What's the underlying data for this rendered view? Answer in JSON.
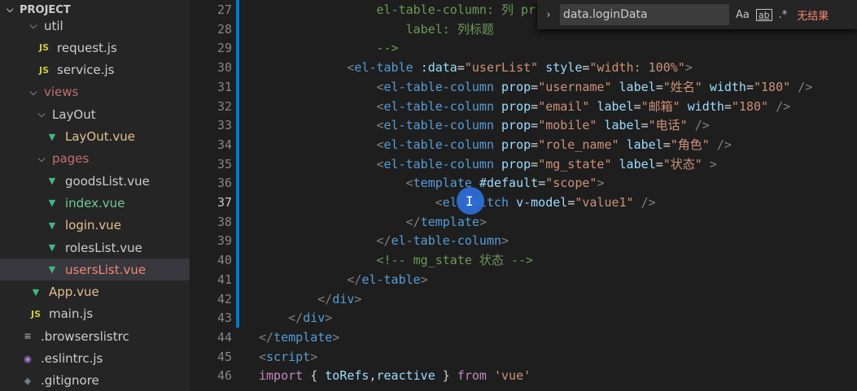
{
  "explorer": {
    "project_title": "PROJECT",
    "items": [
      {
        "name": "util",
        "kind": "folder",
        "expanded": true,
        "status": "dot"
      },
      {
        "name": "request.js",
        "kind": "js",
        "status": "M"
      },
      {
        "name": "service.js",
        "kind": "js",
        "status": "M"
      },
      {
        "name": "views",
        "kind": "folder",
        "expanded": true,
        "status": "dot"
      },
      {
        "name": "LayOut",
        "kind": "folder",
        "expanded": true,
        "status": "dot"
      },
      {
        "name": "LayOut.vue",
        "kind": "vue",
        "status": "M"
      },
      {
        "name": "pages",
        "kind": "folder",
        "expanded": true,
        "status": "dot"
      },
      {
        "name": "goodsList.vue",
        "kind": "vue",
        "status": ""
      },
      {
        "name": "index.vue",
        "kind": "vue",
        "status": "U"
      },
      {
        "name": "login.vue",
        "kind": "vue",
        "status": "M"
      },
      {
        "name": "rolesList.vue",
        "kind": "vue",
        "status": ""
      },
      {
        "name": "usersList.vue",
        "kind": "vue",
        "status": "1, M"
      },
      {
        "name": "App.vue",
        "kind": "vue",
        "status": "M"
      },
      {
        "name": "main.js",
        "kind": "js",
        "status": ""
      },
      {
        "name": ".browserslistrc",
        "kind": "lines",
        "status": ""
      },
      {
        "name": ".eslintrc.js",
        "kind": "eslint",
        "status": ""
      },
      {
        "name": ".gitignore",
        "kind": "git",
        "status": ""
      }
    ]
  },
  "find": {
    "query": "data.loginData",
    "case_label": "Aa",
    "word_label": "ab",
    "regex_label": ".*",
    "status": "无结果"
  },
  "editor": {
    "active_line": 37,
    "lines": [
      {
        "n": 27,
        "indent": "        ",
        "tokens": [
          [
            "cmt",
            "el-table-column: 列 pr"
          ]
        ]
      },
      {
        "n": 28,
        "indent": "          ",
        "tokens": [
          [
            "cmt",
            "label: 列标题"
          ]
        ]
      },
      {
        "n": 29,
        "indent": "        ",
        "tokens": [
          [
            "cmt",
            "-->"
          ]
        ]
      },
      {
        "n": 30,
        "indent": "      ",
        "tokens": [
          [
            "punct",
            "<"
          ],
          [
            "tag",
            "el-table"
          ],
          [
            "plain",
            " "
          ],
          [
            "attr",
            ":data"
          ],
          [
            "plain",
            "="
          ],
          [
            "str",
            "\"userList\""
          ],
          [
            "plain",
            " "
          ],
          [
            "attr",
            "style"
          ],
          [
            "plain",
            "="
          ],
          [
            "str",
            "\"width: 100%\""
          ],
          [
            "punct",
            ">"
          ]
        ]
      },
      {
        "n": 31,
        "indent": "        ",
        "tokens": [
          [
            "punct",
            "<"
          ],
          [
            "tag",
            "el-table-column"
          ],
          [
            "plain",
            " "
          ],
          [
            "attr",
            "prop"
          ],
          [
            "plain",
            "="
          ],
          [
            "str",
            "\"username\""
          ],
          [
            "plain",
            " "
          ],
          [
            "attr",
            "label"
          ],
          [
            "plain",
            "="
          ],
          [
            "str",
            "\"姓名\""
          ],
          [
            "plain",
            " "
          ],
          [
            "attr",
            "width"
          ],
          [
            "plain",
            "="
          ],
          [
            "str",
            "\"180\""
          ],
          [
            "plain",
            " "
          ],
          [
            "punct",
            "/>"
          ]
        ]
      },
      {
        "n": 32,
        "indent": "        ",
        "tokens": [
          [
            "punct",
            "<"
          ],
          [
            "tag",
            "el-table-column"
          ],
          [
            "plain",
            " "
          ],
          [
            "attr",
            "prop"
          ],
          [
            "plain",
            "="
          ],
          [
            "str",
            "\"email\""
          ],
          [
            "plain",
            " "
          ],
          [
            "attr",
            "label"
          ],
          [
            "plain",
            "="
          ],
          [
            "str",
            "\"邮箱\""
          ],
          [
            "plain",
            " "
          ],
          [
            "attr",
            "width"
          ],
          [
            "plain",
            "="
          ],
          [
            "str",
            "\"180\""
          ],
          [
            "plain",
            " "
          ],
          [
            "punct",
            "/>"
          ]
        ]
      },
      {
        "n": 33,
        "indent": "        ",
        "tokens": [
          [
            "punct",
            "<"
          ],
          [
            "tag",
            "el-table-column"
          ],
          [
            "plain",
            " "
          ],
          [
            "attr",
            "prop"
          ],
          [
            "plain",
            "="
          ],
          [
            "str",
            "\"mobile\""
          ],
          [
            "plain",
            " "
          ],
          [
            "attr",
            "label"
          ],
          [
            "plain",
            "="
          ],
          [
            "str",
            "\"电话\""
          ],
          [
            "plain",
            " "
          ],
          [
            "punct",
            "/>"
          ]
        ]
      },
      {
        "n": 34,
        "indent": "        ",
        "tokens": [
          [
            "punct",
            "<"
          ],
          [
            "tag",
            "el-table-column"
          ],
          [
            "plain",
            " "
          ],
          [
            "attr",
            "prop"
          ],
          [
            "plain",
            "="
          ],
          [
            "str",
            "\"role_name\""
          ],
          [
            "plain",
            " "
          ],
          [
            "attr",
            "label"
          ],
          [
            "plain",
            "="
          ],
          [
            "str",
            "\"角色\""
          ],
          [
            "plain",
            " "
          ],
          [
            "punct",
            "/>"
          ]
        ]
      },
      {
        "n": 35,
        "indent": "        ",
        "tokens": [
          [
            "punct",
            "<"
          ],
          [
            "tag",
            "el-table-column"
          ],
          [
            "plain",
            " "
          ],
          [
            "attr",
            "prop"
          ],
          [
            "plain",
            "="
          ],
          [
            "str",
            "\"mg_state\""
          ],
          [
            "plain",
            " "
          ],
          [
            "attr",
            "label"
          ],
          [
            "plain",
            "="
          ],
          [
            "str",
            "\"状态\""
          ],
          [
            "plain",
            " "
          ],
          [
            "punct",
            ">"
          ]
        ]
      },
      {
        "n": 36,
        "indent": "          ",
        "tokens": [
          [
            "punct",
            "<"
          ],
          [
            "tag",
            "template"
          ],
          [
            "plain",
            " "
          ],
          [
            "attr",
            "#default"
          ],
          [
            "plain",
            "="
          ],
          [
            "str",
            "\"scope\""
          ],
          [
            "punct",
            ">"
          ]
        ]
      },
      {
        "n": 37,
        "indent": "            ",
        "tokens": [
          [
            "punct",
            "<"
          ],
          [
            "tag",
            "el-switch"
          ],
          [
            "plain",
            " "
          ],
          [
            "attr",
            "v-model"
          ],
          [
            "plain",
            "="
          ],
          [
            "str",
            "\"value1\""
          ],
          [
            "plain",
            " "
          ],
          [
            "punct",
            "/>"
          ]
        ]
      },
      {
        "n": 38,
        "indent": "          ",
        "tokens": [
          [
            "punct",
            "</"
          ],
          [
            "tag",
            "template"
          ],
          [
            "punct",
            ">"
          ]
        ]
      },
      {
        "n": 39,
        "indent": "        ",
        "tokens": [
          [
            "punct",
            "</"
          ],
          [
            "tag",
            "el-table-column"
          ],
          [
            "punct",
            ">"
          ]
        ]
      },
      {
        "n": 40,
        "indent": "        ",
        "tokens": [
          [
            "cmt",
            "<!-- mg_state 状态 -->"
          ]
        ]
      },
      {
        "n": 41,
        "indent": "      ",
        "tokens": [
          [
            "punct",
            "</"
          ],
          [
            "tag",
            "el-table"
          ],
          [
            "punct",
            ">"
          ]
        ]
      },
      {
        "n": 42,
        "indent": "    ",
        "tokens": [
          [
            "punct",
            "</"
          ],
          [
            "tag",
            "div"
          ],
          [
            "punct",
            ">"
          ]
        ]
      },
      {
        "n": 43,
        "indent": "  ",
        "tokens": [
          [
            "punct",
            "</"
          ],
          [
            "tag",
            "div"
          ],
          [
            "punct",
            ">"
          ]
        ]
      },
      {
        "n": 44,
        "indent": "",
        "tokens": [
          [
            "punct",
            "</"
          ],
          [
            "tag",
            "template"
          ],
          [
            "punct",
            ">"
          ]
        ]
      },
      {
        "n": 45,
        "indent": "",
        "tokens": [
          [
            "punct",
            "<"
          ],
          [
            "tag",
            "script"
          ],
          [
            "punct",
            ">"
          ]
        ]
      },
      {
        "n": 46,
        "indent": "",
        "tokens": [
          [
            "kw",
            "import"
          ],
          [
            "plain",
            " { "
          ],
          [
            "var",
            "toRefs"
          ],
          [
            "plain",
            ","
          ],
          [
            "var",
            "reactive"
          ],
          [
            "plain",
            " } "
          ],
          [
            "kw",
            "from"
          ],
          [
            "plain",
            " "
          ],
          [
            "str",
            "'vue'"
          ]
        ]
      }
    ]
  },
  "colors": {
    "modified": "#e2c08d",
    "untracked": "#73c991",
    "error": "#f48771",
    "accent": "#007acc"
  }
}
